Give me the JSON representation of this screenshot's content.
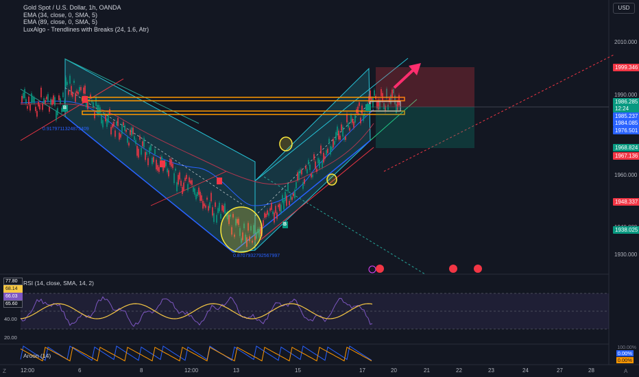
{
  "legend": {
    "title": "Gold Spot / U.S. Dollar, 1h, OANDA",
    "ema34": "EMA (34, close, 0, SMA, 5)",
    "ema89": "EMA (89, close, 0, SMA, 5)",
    "luxalgo": "LuxAlgo - Trendlines with Breaks (24, 1.6, Atr)"
  },
  "currency": "USD",
  "price_axis": {
    "ticks": [
      "2010.000",
      "1990.000",
      "1970.000",
      "1960.000",
      "1950.000",
      "1940.000",
      "1930.000"
    ],
    "labels": [
      {
        "text": "1999.346",
        "color": "#f23645"
      },
      {
        "text": "1986.285",
        "color": "#089981"
      },
      {
        "text": "12:24",
        "color": "#089981"
      },
      {
        "text": "1985.237",
        "color": "#2962ff"
      },
      {
        "text": "1984.085",
        "color": "#2962ff"
      },
      {
        "text": "1976.501",
        "color": "#2962ff"
      },
      {
        "text": "1968.824",
        "color": "#089981"
      },
      {
        "text": "1967.136",
        "color": "#f23645"
      },
      {
        "text": "1948.337",
        "color": "#f23645"
      },
      {
        "text": "1938.025",
        "color": "#089981"
      }
    ]
  },
  "time_axis": [
    "12:00",
    "6",
    "8",
    "12:00",
    "13",
    "15",
    "17",
    "20",
    "21",
    "22",
    "23",
    "24",
    "27",
    "28"
  ],
  "annotations": {
    "slope_top": "0.9179711324873409",
    "slope_bottom": "0.8707932792567997",
    "break_marker": "B"
  },
  "rsi": {
    "title": "RSI (14, close, SMA, 14, 2)",
    "values": [
      {
        "text": "77.80",
        "color": "#ffffff",
        "bg": "#131722",
        "border": "#5d606b"
      },
      {
        "text": "68.14",
        "color": "#131722",
        "bg": "#f7c844",
        "border": "#f7c844"
      },
      {
        "text": "66.03",
        "color": "#ffffff",
        "bg": "#7e57c2",
        "border": "#7e57c2"
      },
      {
        "text": "65.60",
        "color": "#ffffff",
        "bg": "#131722",
        "border": "#5d606b"
      }
    ],
    "ticks": [
      "40.00",
      "20.00"
    ]
  },
  "aroon": {
    "title": "Aroon (14)",
    "top_tick": "100.00%",
    "values": [
      {
        "text": "0.00%",
        "color": "#ffffff",
        "bg": "#2962ff"
      },
      {
        "text": "0.00%",
        "color": "#131722",
        "bg": "#ff9800"
      }
    ]
  },
  "corners": {
    "left": "Z",
    "right": "A"
  }
}
